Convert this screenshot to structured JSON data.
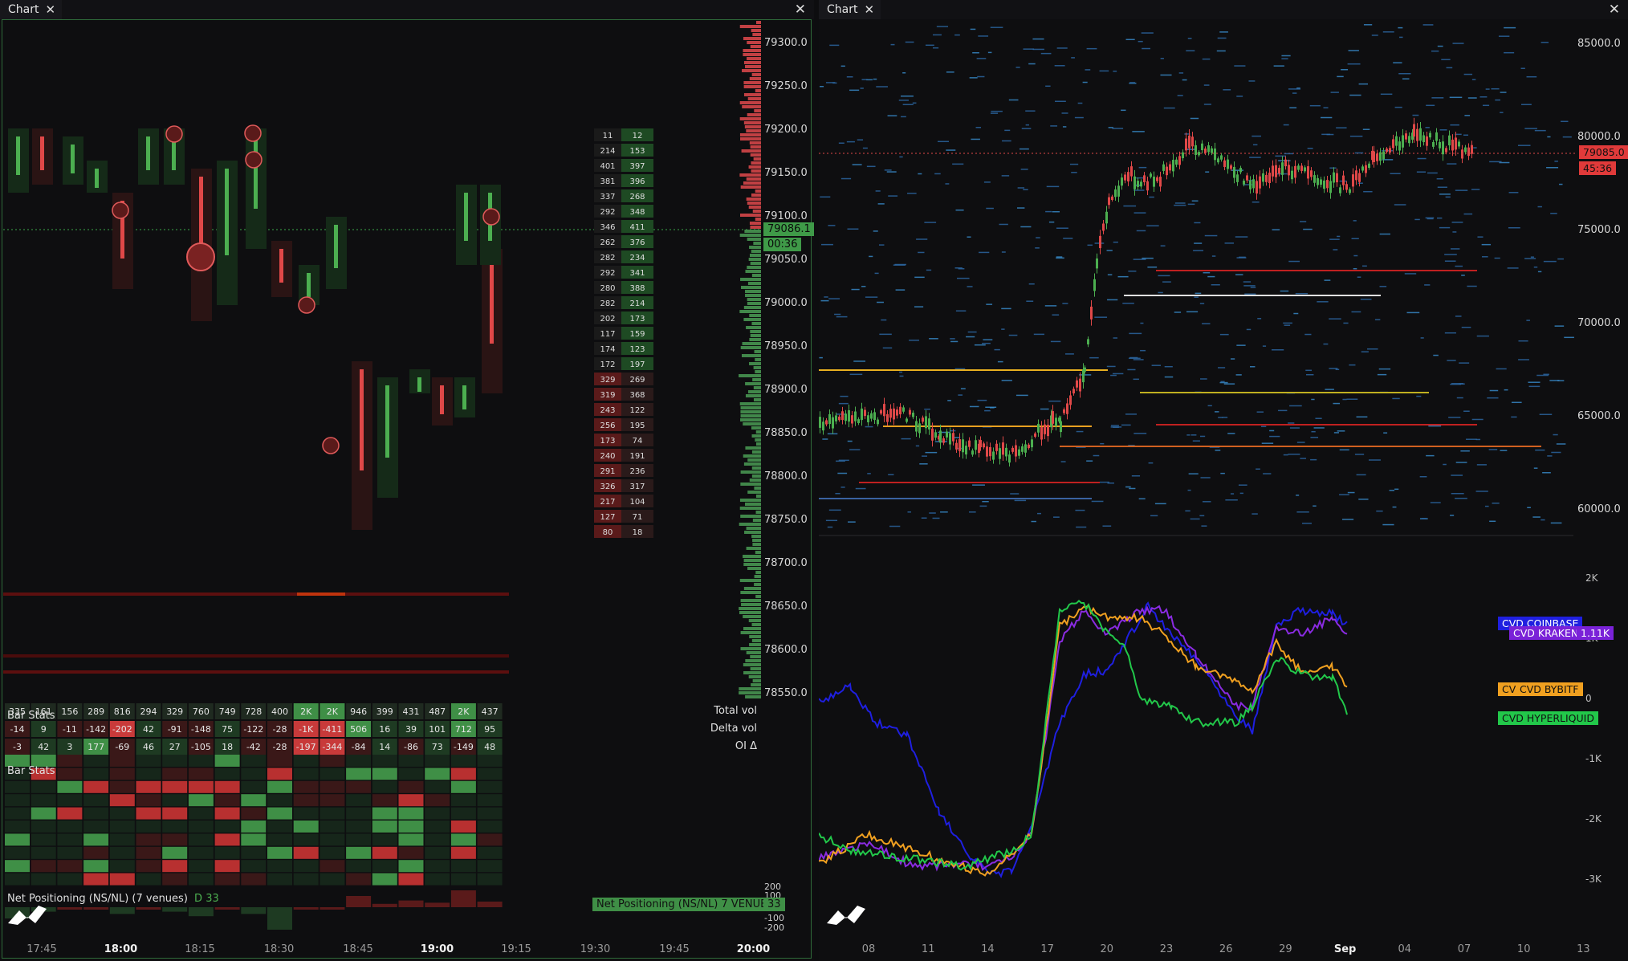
{
  "left": {
    "tab_title": "Chart",
    "price_ticks": [
      "79300.0",
      "79250.0",
      "79200.0",
      "79150.0",
      "79100.0",
      "79050.0",
      "79000.0",
      "78950.0",
      "78900.0",
      "78850.0",
      "78800.0",
      "78750.0",
      "78700.0",
      "78650.0",
      "78600.0",
      "78550.0"
    ],
    "last_price": "79086.1",
    "countdown": "00:36",
    "time_ticks": [
      "17:45",
      "18:00",
      "18:15",
      "18:30",
      "18:45",
      "19:00",
      "19:15",
      "19:30",
      "19:45",
      "20:00"
    ],
    "bold_times": [
      "18:00",
      "19:00",
      "20:00"
    ],
    "bar_stats_label": "Bar Stats",
    "bar_stats_label2": "Bar Stats",
    "row_labels": [
      "Total vol",
      "Delta vol",
      "OI Δ"
    ],
    "total_vol": [
      "335",
      "161",
      "156",
      "289",
      "816",
      "294",
      "329",
      "760",
      "749",
      "728",
      "400",
      "2K",
      "2K",
      "946",
      "399",
      "431",
      "487",
      "2K",
      "437"
    ],
    "delta_vol": [
      "-14",
      "9",
      "-11",
      "-142",
      "-202",
      "42",
      "-91",
      "-148",
      "75",
      "-122",
      "-28",
      "-1K",
      "-411",
      "506",
      "16",
      "39",
      "101",
      "712",
      "95"
    ],
    "oi_delta": [
      "-3",
      "42",
      "3",
      "177",
      "-69",
      "46",
      "27",
      "-105",
      "18",
      "-42",
      "-28",
      "-197",
      "-344",
      "-84",
      "14",
      "-86",
      "73",
      "-149",
      "48"
    ],
    "ladder": [
      [
        "11",
        "12"
      ],
      [
        "214",
        "153"
      ],
      [
        "401",
        "397"
      ],
      [
        "381",
        "396"
      ],
      [
        "337",
        "268"
      ],
      [
        "292",
        "348"
      ],
      [
        "346",
        "411"
      ],
      [
        "262",
        "376"
      ],
      [
        "282",
        "234"
      ],
      [
        "292",
        "341"
      ],
      [
        "280",
        "388"
      ],
      [
        "282",
        "214"
      ],
      [
        "202",
        "173"
      ],
      [
        "117",
        "159"
      ],
      [
        "174",
        "123"
      ],
      [
        "172",
        "197"
      ],
      [
        "329",
        "269"
      ],
      [
        "319",
        "368"
      ],
      [
        "243",
        "122"
      ],
      [
        "256",
        "195"
      ],
      [
        "173",
        "74"
      ],
      [
        "240",
        "191"
      ],
      [
        "291",
        "236"
      ],
      [
        "326",
        "317"
      ],
      [
        "217",
        "104"
      ],
      [
        "127",
        "71"
      ],
      [
        "80",
        "18"
      ]
    ],
    "net_positioning_title": "Net Positioning (NS/NL) (7 venues)",
    "net_positioning_value": "D 33",
    "net_positioning_tag": "Net Positioning (NS/NL) 7 VENUES",
    "net_positioning_tag_value": "33",
    "np_ticks": [
      "200",
      "100",
      "-100",
      "-200"
    ],
    "np_values": [
      -10,
      -4,
      0,
      0,
      -6,
      0,
      -4,
      -8,
      0,
      -6,
      -20,
      0,
      0,
      10,
      3,
      6,
      4,
      15,
      5
    ]
  },
  "right": {
    "tab_title": "Chart",
    "price_ticks": [
      "85000.0",
      "80000.0",
      "75000.0",
      "70000.0",
      "65000.0",
      "60000.0"
    ],
    "last_price": "79085.0",
    "countdown": "45:36",
    "cvd_ticks": [
      "2K",
      "1K",
      "0",
      "-1K",
      "-2K",
      "-3K"
    ],
    "date_ticks": [
      "08",
      "11",
      "14",
      "17",
      "20",
      "23",
      "26",
      "29",
      "Sep",
      "04",
      "07",
      "10",
      "13"
    ],
    "legend": [
      {
        "name": "CVD COINBASE",
        "color": "#1f1fe0"
      },
      {
        "name": "CVD KRAKEN",
        "color": "#8a2be2",
        "value": "1.11K"
      },
      {
        "name": "CVD BYBITF",
        "color": "#f0a020",
        "prefix": "CV"
      },
      {
        "name": "CVD HYPERLIQUID",
        "color": "#22c84a"
      }
    ]
  }
}
